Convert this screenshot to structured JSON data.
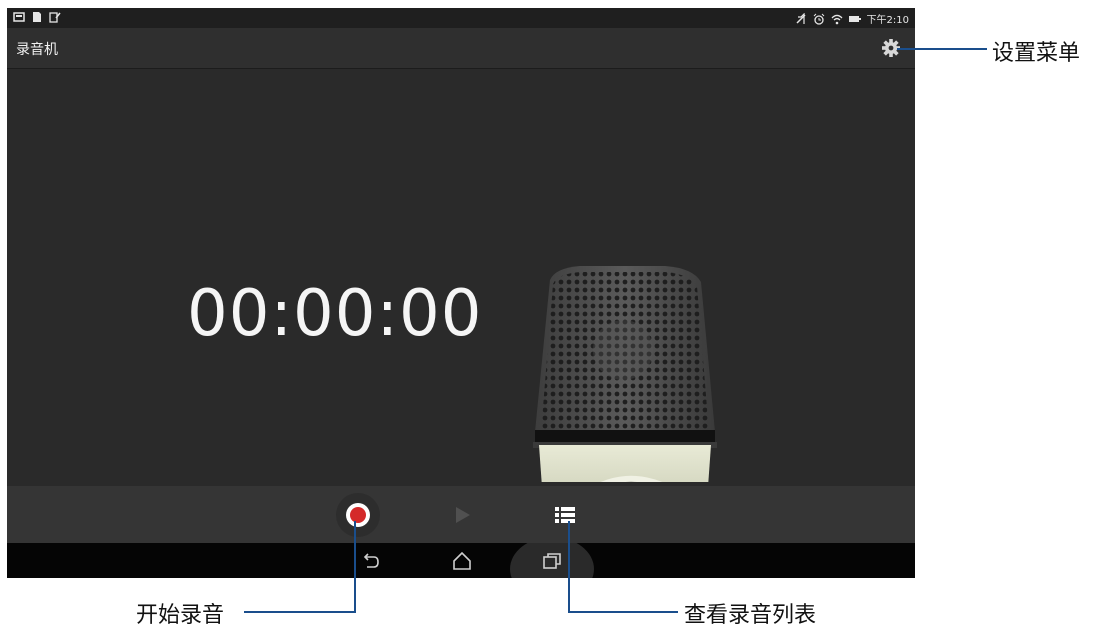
{
  "status_bar": {
    "time": "下午2:10"
  },
  "app_bar": {
    "title": "录音机"
  },
  "main": {
    "timer": "00:00:00"
  },
  "controls": {
    "record_icon": "record-icon",
    "play_icon": "play-icon",
    "list_icon": "list-icon"
  },
  "nav": {
    "back_icon": "back-icon",
    "home_icon": "home-icon",
    "recents_icon": "recents-icon"
  },
  "annotations": {
    "settings_menu": "设置菜单",
    "start_recording": "开始录音",
    "view_recording_list": "查看录音列表"
  },
  "colors": {
    "record_red": "#d42a2a",
    "callout_line": "#1a4e8c"
  }
}
